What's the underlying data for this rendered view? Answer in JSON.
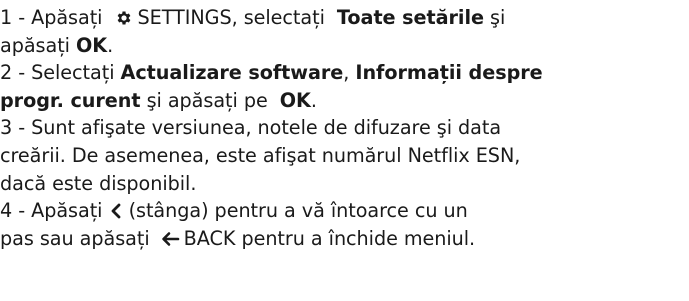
{
  "steps": [
    {
      "l1": {
        "pre": "1 -  Apăsați ",
        "settings_label": "SETTINGS",
        "mid": ", selectați ",
        "bold": "Toate setările",
        "post": " şi"
      },
      "l2": {
        "pre": "apăsați ",
        "bold": "OK",
        "post": "."
      }
    },
    {
      "l1": {
        "pre": "2 -  Selectați ",
        "bold1": "Actualizare software",
        "sep": ", ",
        "bold2": "Informații despre"
      },
      "l2": {
        "bold": "progr. curent",
        "mid": " şi apăsați pe ",
        "bold_ok": "OK",
        "post": "."
      }
    },
    {
      "lines": [
        "3 -  Sunt afişate versiunea, notele de difuzare şi data",
        "creării. De asemenea, este afişat numărul Netflix ESN,",
        "dacă este disponibil."
      ]
    },
    {
      "l1": {
        "pre": "4 -  Apăsați ",
        "post": " (stânga) pentru a vă întoarce cu un"
      },
      "l2": {
        "pre": "pas sau apăsați ",
        "back_label": "BACK",
        "post": " pentru a închide meniul."
      }
    }
  ],
  "icons": {
    "settings": "gear-icon",
    "left": "chevron-left-icon",
    "back": "arrow-left-icon"
  }
}
